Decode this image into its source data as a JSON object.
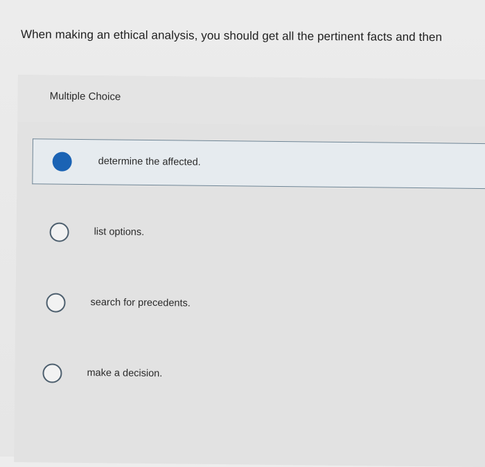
{
  "question": {
    "text": "When making an ethical analysis, you should get all the pertinent facts and then"
  },
  "quiz": {
    "type_label": "Multiple Choice",
    "options": [
      {
        "label": "determine the affected.",
        "selected": true
      },
      {
        "label": "list options.",
        "selected": false
      },
      {
        "label": "search for precedents.",
        "selected": false
      },
      {
        "label": "make a decision.",
        "selected": false
      }
    ]
  },
  "colors": {
    "selected_radio": "#1b63b4",
    "selected_border": "#6f8595",
    "selected_background": "#e6ebef"
  }
}
